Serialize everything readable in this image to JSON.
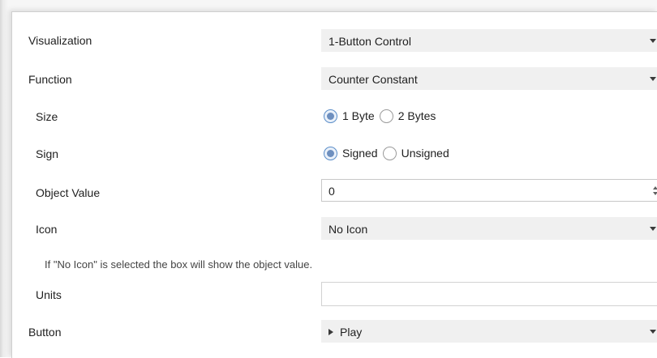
{
  "rows": {
    "visualization": {
      "label": "Visualization",
      "value": "1-Button Control"
    },
    "function": {
      "label": "Function",
      "value": "Counter Constant"
    },
    "size": {
      "label": "Size",
      "options": [
        "1 Byte",
        "2 Bytes"
      ],
      "selected": "1 Byte"
    },
    "sign": {
      "label": "Sign",
      "options": [
        "Signed",
        "Unsigned"
      ],
      "selected": "Signed"
    },
    "object_value": {
      "label": "Object Value",
      "value": "0"
    },
    "icon": {
      "label": "Icon",
      "value": "No Icon"
    },
    "note": "If \"No Icon\" is selected the box will show the object value.",
    "units": {
      "label": "Units",
      "value": ""
    },
    "button": {
      "label": "Button",
      "value": "Play",
      "icon": "play-icon"
    }
  },
  "colors": {
    "select_bg": "#f0f0f0",
    "radio_accent": "#6d8fbf"
  }
}
